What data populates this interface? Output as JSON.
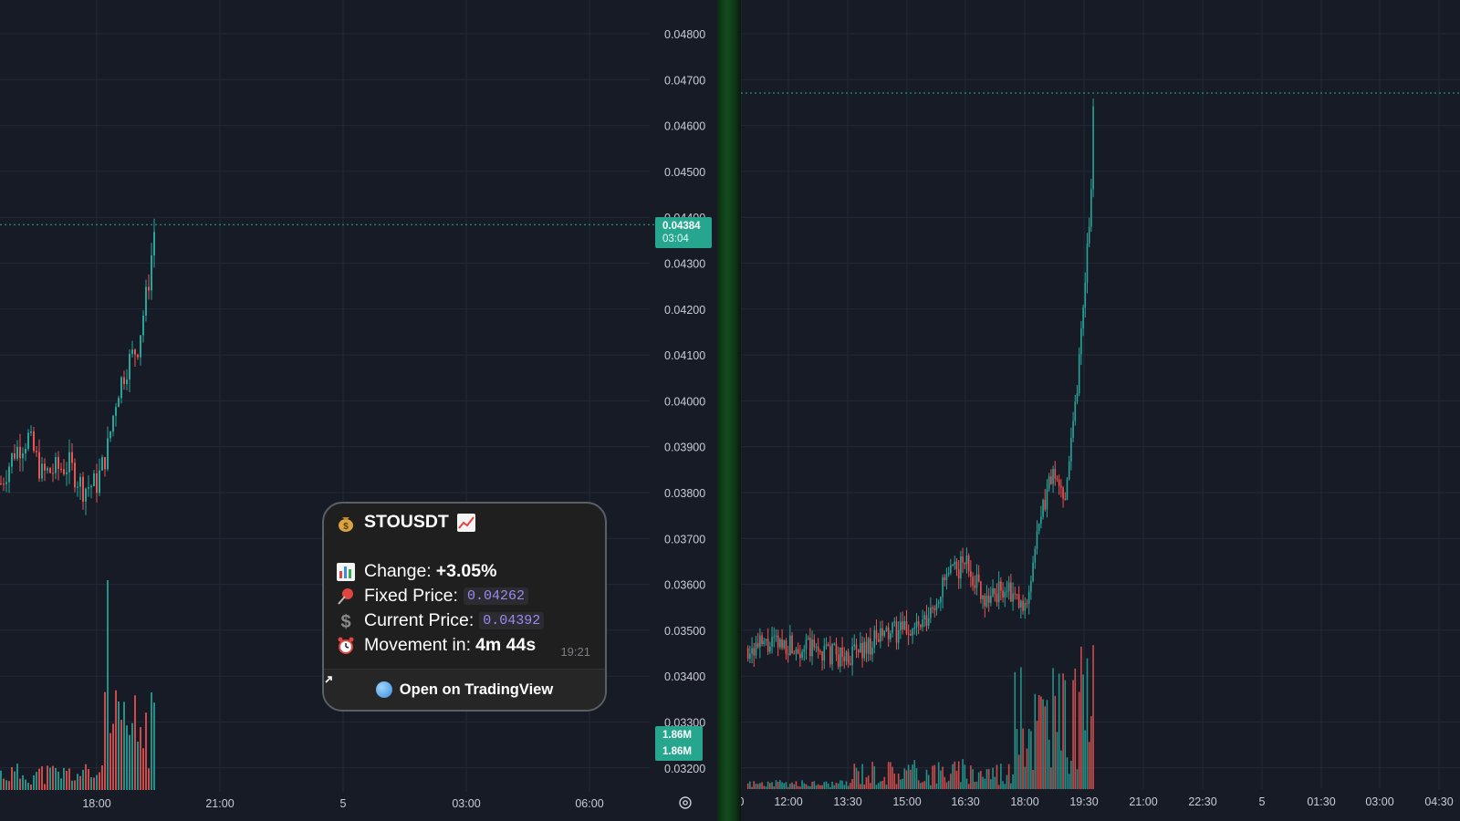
{
  "left_chart": {
    "y_ticks": [
      "0.04800",
      "0.04700",
      "0.04600",
      "0.04500",
      "0.04400",
      "0.04300",
      "0.04200",
      "0.04100",
      "0.04000",
      "0.03900",
      "0.03800",
      "0.03700",
      "0.03600",
      "0.03500",
      "0.03400",
      "0.03300",
      "0.03200"
    ],
    "x_ticks": [
      "18:00",
      "21:00",
      "5",
      "03:00",
      "06:00"
    ],
    "price_badge": {
      "price": "0.04384",
      "countdown": "03:04"
    },
    "volume_badges": [
      "1.86M",
      "1.86M"
    ],
    "colors": {
      "up": "#26a69a",
      "down": "#ef5350",
      "background": "#171b26",
      "grid": "#232838"
    }
  },
  "right_chart": {
    "x_ticks": [
      "0",
      "12:00",
      "13:30",
      "15:00",
      "16:30",
      "18:00",
      "19:30",
      "21:00",
      "22:30",
      "5",
      "01:30",
      "03:00",
      "04:30"
    ]
  },
  "alert": {
    "title": "STOUSDT",
    "title_icons": [
      "money-bag-icon",
      "chart-increasing-icon"
    ],
    "change_label": "Change:",
    "change_value": "+3.05%",
    "fixed_label": "Fixed Price:",
    "fixed_value": "0.04262",
    "current_label": "Current Price:",
    "current_value": "0.04392",
    "movement_label": "Movement in:",
    "movement_value": "4m 44s",
    "timestamp": "19:21",
    "button_label": "Open on TradingView"
  },
  "chart_data": [
    {
      "type": "candlestick",
      "title": "",
      "symbol": "STOUSDT",
      "x_ticks": [
        "18:00",
        "21:00",
        "5",
        "03:00",
        "06:00"
      ],
      "ylim": [
        0.0318,
        0.0488
      ],
      "y_ticks": [
        0.048,
        0.047,
        0.046,
        0.045,
        0.044,
        0.043,
        0.042,
        0.041,
        0.04,
        0.039,
        0.038,
        0.037,
        0.036,
        0.035,
        0.034,
        0.033,
        0.032
      ],
      "last_price": 0.04384,
      "close_path": [
        {
          "time": "15:40",
          "close": 0.0382
        },
        {
          "time": "16:00",
          "close": 0.0389
        },
        {
          "time": "16:20",
          "close": 0.0392
        },
        {
          "time": "16:40",
          "close": 0.0384
        },
        {
          "time": "17:00",
          "close": 0.0385
        },
        {
          "time": "17:20",
          "close": 0.0386
        },
        {
          "time": "17:40",
          "close": 0.0381
        },
        {
          "time": "18:00",
          "close": 0.0382
        },
        {
          "time": "18:15",
          "close": 0.0389
        },
        {
          "time": "18:30",
          "close": 0.0402
        },
        {
          "time": "18:45",
          "close": 0.0408
        },
        {
          "time": "19:00",
          "close": 0.0412
        },
        {
          "time": "19:15",
          "close": 0.0425
        },
        {
          "time": "19:25",
          "close": 0.04384
        }
      ],
      "volume_badge": "1.86M"
    },
    {
      "type": "candlestick",
      "title": "",
      "x_ticks": [
        "0",
        "12:00",
        "13:30",
        "15:00",
        "16:30",
        "18:00",
        "19:30",
        "21:00",
        "22:30",
        "5",
        "01:30",
        "03:00",
        "04:30"
      ],
      "close_path": [
        {
          "time": "11:00",
          "close": 0.0347
        },
        {
          "time": "12:00",
          "close": 0.0348
        },
        {
          "time": "13:30",
          "close": 0.0345
        },
        {
          "time": "14:30",
          "close": 0.035
        },
        {
          "time": "15:30",
          "close": 0.0352
        },
        {
          "time": "16:00",
          "close": 0.0362
        },
        {
          "time": "16:30",
          "close": 0.0366
        },
        {
          "time": "17:00",
          "close": 0.0358
        },
        {
          "time": "17:30",
          "close": 0.036
        },
        {
          "time": "18:00",
          "close": 0.0355
        },
        {
          "time": "18:20",
          "close": 0.0372
        },
        {
          "time": "18:40",
          "close": 0.0385
        },
        {
          "time": "19:00",
          "close": 0.038
        },
        {
          "time": "19:20",
          "close": 0.0405
        },
        {
          "time": "19:30",
          "close": 0.0425
        },
        {
          "time": "19:40",
          "close": 0.0445
        },
        {
          "time": "19:45",
          "close": 0.0468
        }
      ]
    }
  ]
}
